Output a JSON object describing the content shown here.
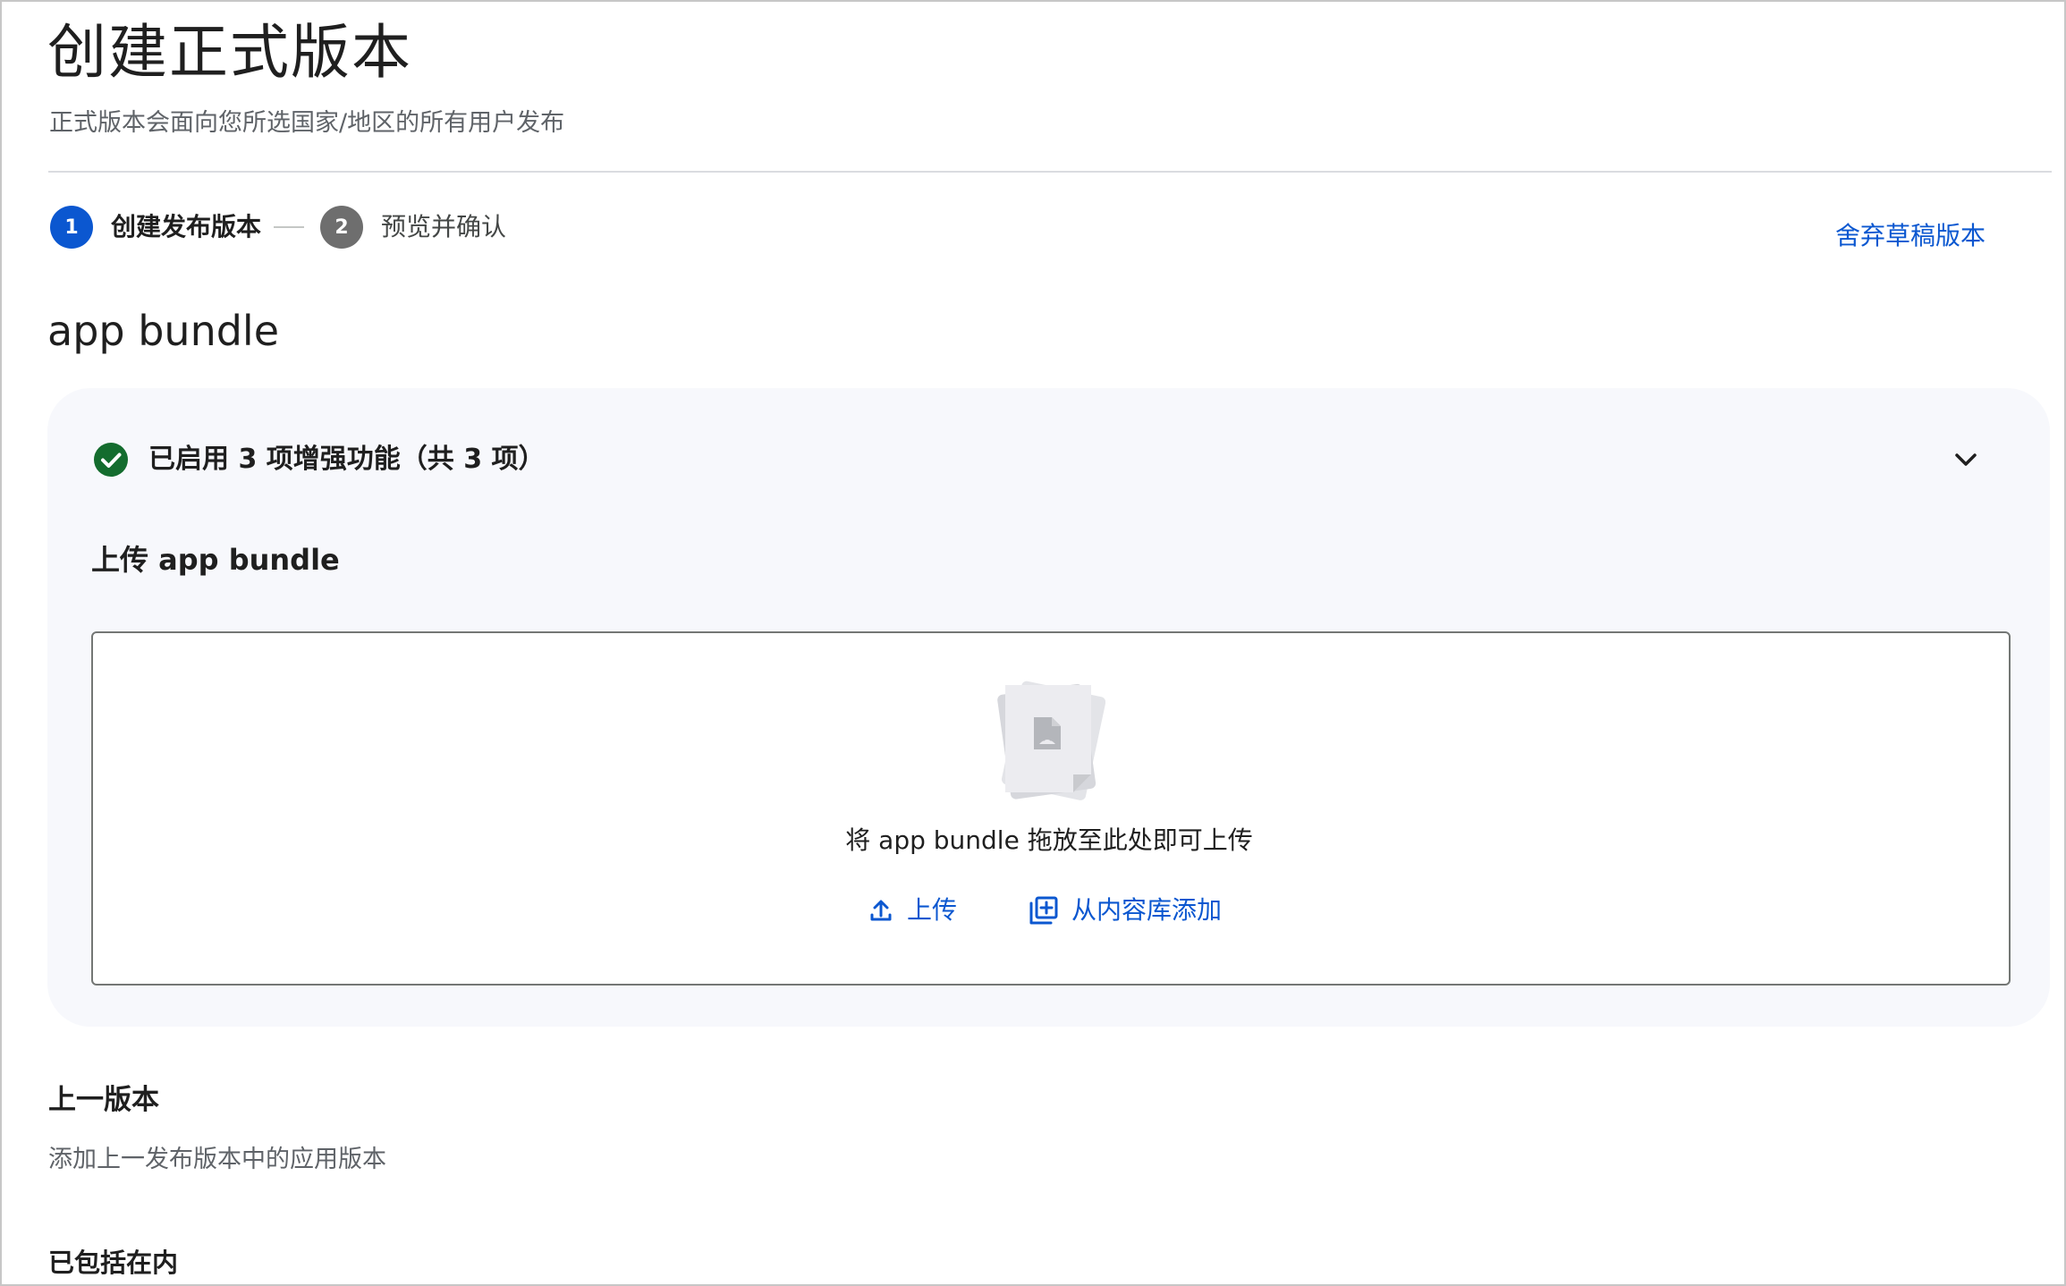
{
  "header": {
    "title": "创建正式版本",
    "subtitle": "正式版本会面向您所选国家/地区的所有用户发布"
  },
  "stepper": {
    "steps": [
      {
        "number": "1",
        "label": "创建发布版本",
        "state": "active"
      },
      {
        "number": "2",
        "label": "预览并确认",
        "state": "inactive"
      }
    ],
    "discard_label": "舍弃草稿版本"
  },
  "app_bundle_section": {
    "heading": "app bundle",
    "enhancements_text": "已启用 3 项增强功能（共 3 项）",
    "upload_title": "上传 app bundle",
    "drop_text": "将 app bundle 拖放至此处即可上传",
    "upload_button": "上传",
    "library_button": "从内容库添加"
  },
  "previous_release": {
    "title": "上一版本",
    "subtitle": "添加上一发布版本中的应用版本",
    "included_title": "已包括在内"
  },
  "colors": {
    "primary": "#0b57d0",
    "success": "#146c2e",
    "card_bg": "#f7f8fc"
  },
  "icons": {
    "check": "check-circle-icon",
    "chevron": "chevron-down-icon",
    "file": "file-document-icon",
    "upload": "upload-icon",
    "library": "library-add-icon"
  }
}
